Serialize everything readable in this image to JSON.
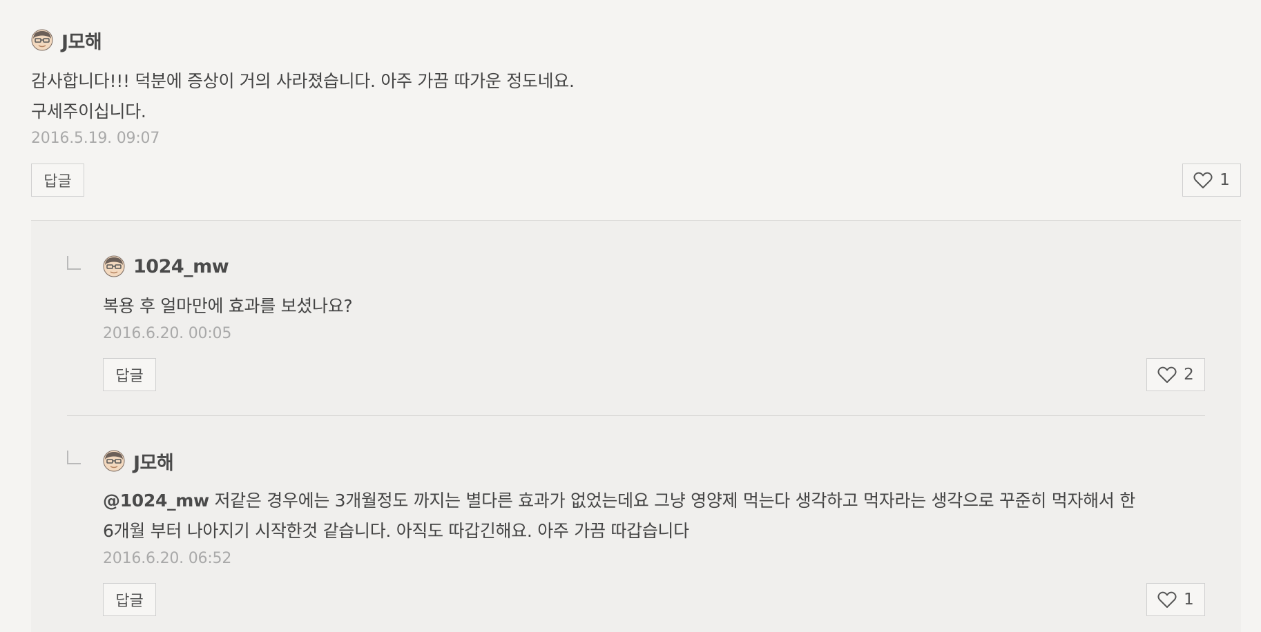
{
  "top_comment": {
    "author": "J모해",
    "text_line1": "감사합니다!!! 덕분에 증상이 거의 사라졌습니다. 아주 가끔 따가운 정도네요.",
    "text_line2": "구세주이십니다.",
    "timestamp": "2016.5.19. 09:07",
    "reply_label": "답글",
    "like_count": "1"
  },
  "replies": [
    {
      "author": "1024_mw",
      "text": "복용 후 얼마만에 효과를 보셨나요?",
      "timestamp": "2016.6.20. 00:05",
      "reply_label": "답글",
      "like_count": "2"
    },
    {
      "author": "J모해",
      "mention": "@1024_mw",
      "text_line1": " 저같은 경우에는 3개월정도 까지는 별다른 효과가 없었는데요 그냥 영양제 먹는다 생각하고 먹자라는 생각으로 꾸준히 먹자해서 한",
      "text_line2": "6개월 부터 나아지기 시작한것 같습니다. 아직도 따갑긴해요. 아주 가끔 따갑습니다",
      "timestamp": "2016.6.20. 06:52",
      "reply_label": "답글",
      "like_count": "1"
    }
  ],
  "icons": {
    "avatar": "avatar-icon",
    "like": "heart-icon",
    "reply_indicator": "reply-corner-icon"
  },
  "colors": {
    "background": "#f5f4f2",
    "reply_background": "#f0efed",
    "timestamp": "#a9a9a9",
    "border": "#cfcfcf"
  }
}
